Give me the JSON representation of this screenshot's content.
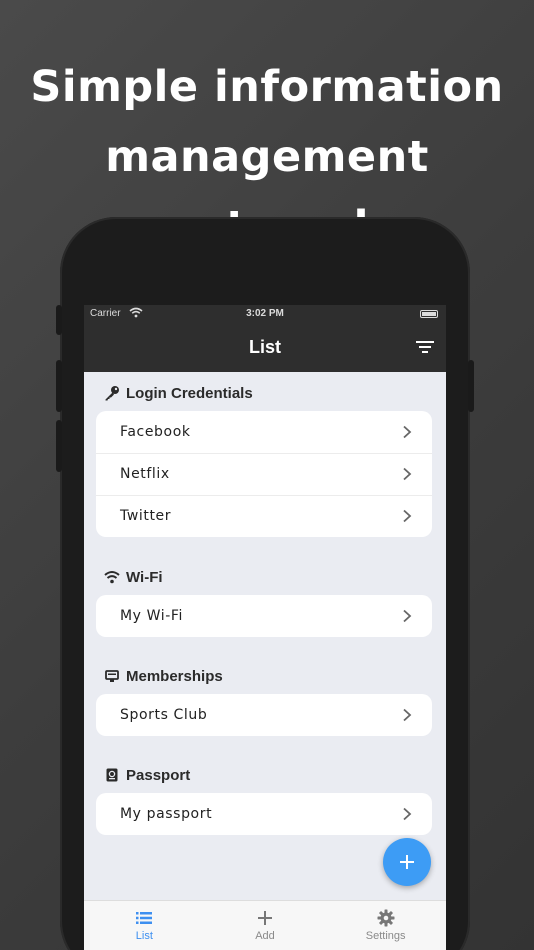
{
  "headline": {
    "line1": "Simple information",
    "line2": "management notepad"
  },
  "statusbar": {
    "carrier": "Carrier",
    "time": "3:02 PM"
  },
  "navbar": {
    "title": "List"
  },
  "sections": [
    {
      "title": "Login Credentials",
      "icon": "key-icon",
      "items": [
        "Facebook",
        "Netflix",
        "Twitter"
      ]
    },
    {
      "title": "Wi-Fi",
      "icon": "wifi-icon",
      "items": [
        "My Wi-Fi"
      ]
    },
    {
      "title": "Memberships",
      "icon": "card-icon",
      "items": [
        "Sports Club"
      ]
    },
    {
      "title": "Passport",
      "icon": "passport-icon",
      "items": [
        "My passport"
      ]
    }
  ],
  "tabbar": {
    "tabs": [
      {
        "label": "List",
        "icon": "list-icon",
        "active": true
      },
      {
        "label": "Add",
        "icon": "plus-icon",
        "active": false
      },
      {
        "label": "Settings",
        "icon": "gear-icon",
        "active": false
      }
    ]
  },
  "colors": {
    "accent": "#3d9cf5",
    "tab_active": "#3d8ff0",
    "navbar": "#2e2e2e",
    "list_background": "#eaecf2"
  }
}
